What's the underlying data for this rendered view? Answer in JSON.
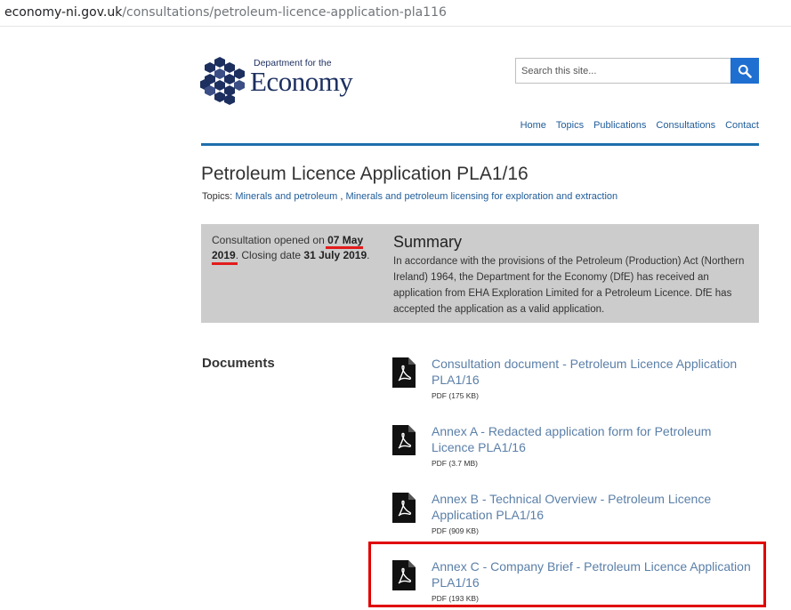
{
  "browser": {
    "url_host": "economy-ni.gov.uk",
    "url_path": "/consultations/petroleum-licence-application-pla116"
  },
  "logo": {
    "line1": "Department for the",
    "line2": "Economy",
    "color": "#1c2f5f"
  },
  "search": {
    "placeholder": "Search this site...",
    "icon": "search-icon",
    "button_color": "#1f6fd1"
  },
  "nav": {
    "items": [
      {
        "label": "Home"
      },
      {
        "label": "Topics"
      },
      {
        "label": "Publications"
      },
      {
        "label": "Consultations"
      },
      {
        "label": "Contact"
      }
    ],
    "rule_color": "#1f6fad"
  },
  "page": {
    "title": "Petroleum Licence Application PLA1/16",
    "topics_label": "Topics:",
    "topics": [
      {
        "label": "Minerals and petroleum"
      },
      {
        "label": "Minerals and petroleum licensing for exploration and extraction"
      }
    ],
    "topics_separator": " , "
  },
  "consultation": {
    "opened_prefix": "Consultation opened on ",
    "opened_date": "07 May 2019",
    "closing_prefix": ". Closing date ",
    "closing_date": "31 July 2019",
    "closing_suffix": "."
  },
  "summary": {
    "heading": "Summary",
    "text": "In accordance with the provisions of the Petroleum (Production) Act (Northern Ireland) 1964, the Department for the Economy (DfE) has received an application from EHA Exploration Limited for a Petroleum Licence. DfE has accepted the application as a valid application.",
    "box_color": "#cccccc"
  },
  "documents": {
    "heading": "Documents",
    "items": [
      {
        "title": "Consultation document - Petroleum Licence Application PLA1/16",
        "meta": "PDF (175 KB)",
        "icon": "pdf-icon"
      },
      {
        "title": "Annex A - Redacted application form for Petroleum Licence PLA1/16",
        "meta": "PDF (3.7 MB)",
        "icon": "pdf-icon"
      },
      {
        "title": "Annex B - Technical Overview - Petroleum Licence Application PLA1/16",
        "meta": "PDF (909 KB)",
        "icon": "pdf-icon"
      },
      {
        "title": "Annex C - Company Brief - Petroleum Licence Application PLA1/16",
        "meta": "PDF (193 KB)",
        "icon": "pdf-icon"
      }
    ]
  },
  "annotations": {
    "highlight_color": "#e00000",
    "underline_color": "#e21c1c"
  }
}
